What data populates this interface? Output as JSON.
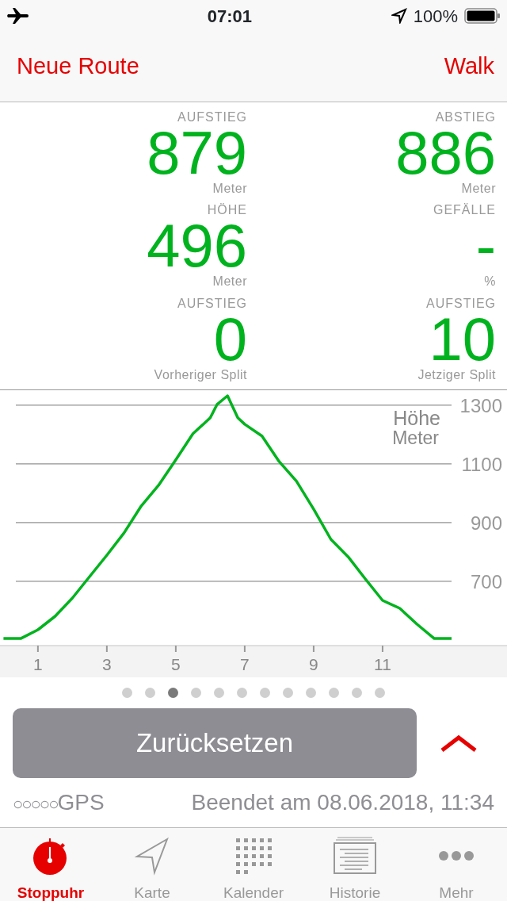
{
  "status_bar": {
    "time": "07:01",
    "battery": "100%"
  },
  "nav": {
    "left": "Neue Route",
    "right": "Walk"
  },
  "stats": [
    {
      "label": "AUFSTIEG",
      "value": "879",
      "unit": "Meter"
    },
    {
      "label": "ABSTIEG",
      "value": "886",
      "unit": "Meter"
    },
    {
      "label": "HÖHE",
      "value": "496",
      "unit": "Meter"
    },
    {
      "label": "GEFÄLLE",
      "value": "-",
      "unit": "%"
    },
    {
      "label": "AUFSTIEG",
      "value": "0",
      "unit": "Vorheriger Split"
    },
    {
      "label": "AUFSTIEG",
      "value": "10",
      "unit": "Jetziger Split"
    }
  ],
  "elevation": {
    "unit": "Meter",
    "chart_data": {
      "type": "line",
      "ylabel": "Höhe",
      "x": [
        0,
        0.5,
        1,
        1.5,
        2,
        2.5,
        3,
        3.5,
        4,
        4.5,
        5,
        5.5,
        6,
        6.2,
        6.5,
        6.8,
        7,
        7.5,
        8,
        8.5,
        9,
        9.5,
        10,
        10.5,
        11,
        11.5,
        12,
        12.5,
        13
      ],
      "series": [
        {
          "color": "#00b31e",
          "values": [
            505,
            505,
            535,
            581,
            643,
            716,
            789,
            865,
            957,
            1027,
            1114,
            1203,
            1257,
            1303,
            1332,
            1257,
            1235,
            1195,
            1108,
            1041,
            946,
            843,
            784,
            708,
            635,
            608,
            554,
            505,
            505
          ]
        }
      ],
      "xticks": [
        1,
        3,
        5,
        7,
        9,
        11
      ],
      "yticks": [
        700,
        900,
        1100,
        1300
      ],
      "xlim": [
        -0.1,
        14.61
      ],
      "ylim": [
        481,
        1351
      ],
      "grid": true
    }
  },
  "pages": [
    {
      "selected": false
    },
    {
      "selected": false
    },
    {
      "selected": true
    },
    {
      "selected": false
    },
    {
      "selected": false
    },
    {
      "selected": false
    },
    {
      "selected": false
    },
    {
      "selected": false
    },
    {
      "selected": false
    },
    {
      "selected": false
    },
    {
      "selected": false
    },
    {
      "selected": false
    }
  ],
  "reset_button": "Zurücksetzen",
  "gps": {
    "signal": "○○○○○",
    "label": "GPS"
  },
  "finished": "Beendet am 08.06.2018, 11:34",
  "tabs": [
    {
      "kind": "stopwatch",
      "label": "Stoppuhr",
      "selected": true
    },
    {
      "kind": "map",
      "label": "Karte",
      "selected": false
    },
    {
      "kind": "calendar",
      "label": "Kalender",
      "selected": false
    },
    {
      "kind": "history",
      "label": "Historie",
      "selected": false
    },
    {
      "kind": "more",
      "label": "Mehr",
      "selected": false
    }
  ]
}
